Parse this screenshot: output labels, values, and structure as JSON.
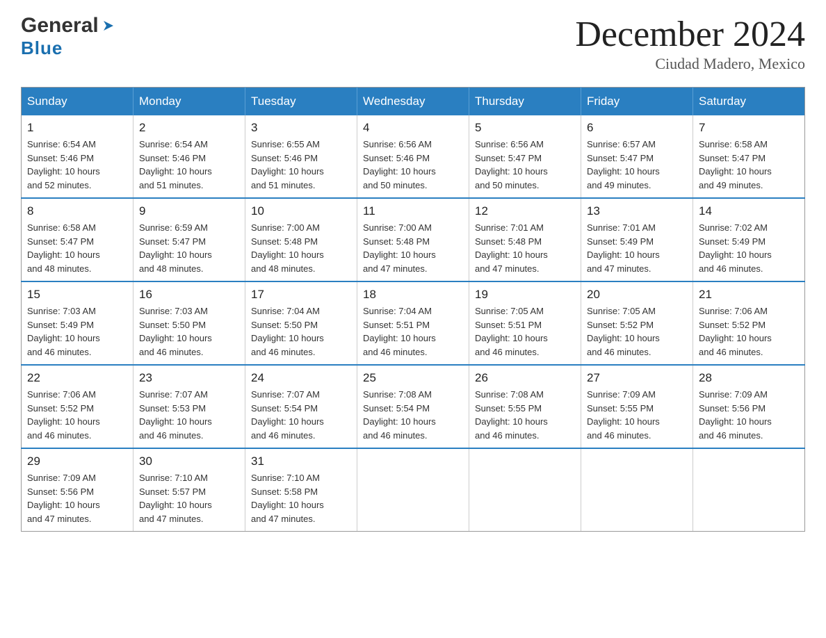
{
  "header": {
    "logo_general": "General",
    "logo_blue": "Blue",
    "month_title": "December 2024",
    "location": "Ciudad Madero, Mexico"
  },
  "days_of_week": [
    "Sunday",
    "Monday",
    "Tuesday",
    "Wednesday",
    "Thursday",
    "Friday",
    "Saturday"
  ],
  "weeks": [
    [
      {
        "day": "1",
        "sunrise": "6:54 AM",
        "sunset": "5:46 PM",
        "daylight": "10 hours and 52 minutes."
      },
      {
        "day": "2",
        "sunrise": "6:54 AM",
        "sunset": "5:46 PM",
        "daylight": "10 hours and 51 minutes."
      },
      {
        "day": "3",
        "sunrise": "6:55 AM",
        "sunset": "5:46 PM",
        "daylight": "10 hours and 51 minutes."
      },
      {
        "day": "4",
        "sunrise": "6:56 AM",
        "sunset": "5:46 PM",
        "daylight": "10 hours and 50 minutes."
      },
      {
        "day": "5",
        "sunrise": "6:56 AM",
        "sunset": "5:47 PM",
        "daylight": "10 hours and 50 minutes."
      },
      {
        "day": "6",
        "sunrise": "6:57 AM",
        "sunset": "5:47 PM",
        "daylight": "10 hours and 49 minutes."
      },
      {
        "day": "7",
        "sunrise": "6:58 AM",
        "sunset": "5:47 PM",
        "daylight": "10 hours and 49 minutes."
      }
    ],
    [
      {
        "day": "8",
        "sunrise": "6:58 AM",
        "sunset": "5:47 PM",
        "daylight": "10 hours and 48 minutes."
      },
      {
        "day": "9",
        "sunrise": "6:59 AM",
        "sunset": "5:47 PM",
        "daylight": "10 hours and 48 minutes."
      },
      {
        "day": "10",
        "sunrise": "7:00 AM",
        "sunset": "5:48 PM",
        "daylight": "10 hours and 48 minutes."
      },
      {
        "day": "11",
        "sunrise": "7:00 AM",
        "sunset": "5:48 PM",
        "daylight": "10 hours and 47 minutes."
      },
      {
        "day": "12",
        "sunrise": "7:01 AM",
        "sunset": "5:48 PM",
        "daylight": "10 hours and 47 minutes."
      },
      {
        "day": "13",
        "sunrise": "7:01 AM",
        "sunset": "5:49 PM",
        "daylight": "10 hours and 47 minutes."
      },
      {
        "day": "14",
        "sunrise": "7:02 AM",
        "sunset": "5:49 PM",
        "daylight": "10 hours and 46 minutes."
      }
    ],
    [
      {
        "day": "15",
        "sunrise": "7:03 AM",
        "sunset": "5:49 PM",
        "daylight": "10 hours and 46 minutes."
      },
      {
        "day": "16",
        "sunrise": "7:03 AM",
        "sunset": "5:50 PM",
        "daylight": "10 hours and 46 minutes."
      },
      {
        "day": "17",
        "sunrise": "7:04 AM",
        "sunset": "5:50 PM",
        "daylight": "10 hours and 46 minutes."
      },
      {
        "day": "18",
        "sunrise": "7:04 AM",
        "sunset": "5:51 PM",
        "daylight": "10 hours and 46 minutes."
      },
      {
        "day": "19",
        "sunrise": "7:05 AM",
        "sunset": "5:51 PM",
        "daylight": "10 hours and 46 minutes."
      },
      {
        "day": "20",
        "sunrise": "7:05 AM",
        "sunset": "5:52 PM",
        "daylight": "10 hours and 46 minutes."
      },
      {
        "day": "21",
        "sunrise": "7:06 AM",
        "sunset": "5:52 PM",
        "daylight": "10 hours and 46 minutes."
      }
    ],
    [
      {
        "day": "22",
        "sunrise": "7:06 AM",
        "sunset": "5:52 PM",
        "daylight": "10 hours and 46 minutes."
      },
      {
        "day": "23",
        "sunrise": "7:07 AM",
        "sunset": "5:53 PM",
        "daylight": "10 hours and 46 minutes."
      },
      {
        "day": "24",
        "sunrise": "7:07 AM",
        "sunset": "5:54 PM",
        "daylight": "10 hours and 46 minutes."
      },
      {
        "day": "25",
        "sunrise": "7:08 AM",
        "sunset": "5:54 PM",
        "daylight": "10 hours and 46 minutes."
      },
      {
        "day": "26",
        "sunrise": "7:08 AM",
        "sunset": "5:55 PM",
        "daylight": "10 hours and 46 minutes."
      },
      {
        "day": "27",
        "sunrise": "7:09 AM",
        "sunset": "5:55 PM",
        "daylight": "10 hours and 46 minutes."
      },
      {
        "day": "28",
        "sunrise": "7:09 AM",
        "sunset": "5:56 PM",
        "daylight": "10 hours and 46 minutes."
      }
    ],
    [
      {
        "day": "29",
        "sunrise": "7:09 AM",
        "sunset": "5:56 PM",
        "daylight": "10 hours and 47 minutes."
      },
      {
        "day": "30",
        "sunrise": "7:10 AM",
        "sunset": "5:57 PM",
        "daylight": "10 hours and 47 minutes."
      },
      {
        "day": "31",
        "sunrise": "7:10 AM",
        "sunset": "5:58 PM",
        "daylight": "10 hours and 47 minutes."
      },
      null,
      null,
      null,
      null
    ]
  ],
  "labels": {
    "sunrise_prefix": "Sunrise: ",
    "sunset_prefix": "Sunset: ",
    "daylight_prefix": "Daylight: "
  }
}
